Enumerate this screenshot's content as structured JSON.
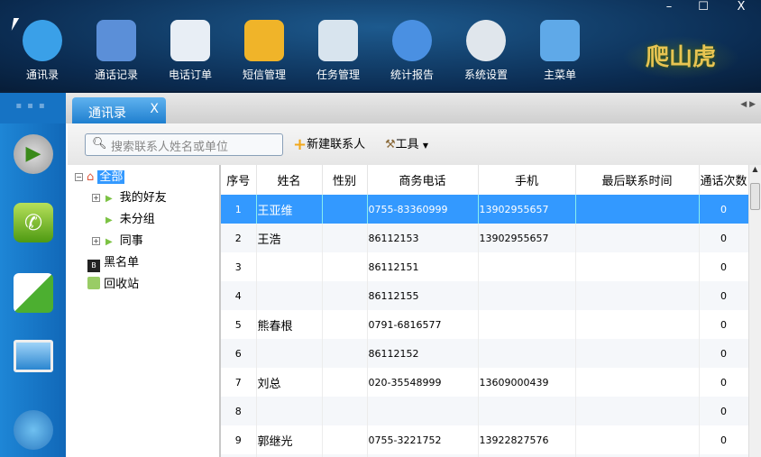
{
  "toolbar": [
    {
      "label": "通讯录",
      "icon": "contacts-icon",
      "color": "#3aa0e8"
    },
    {
      "label": "通话记录",
      "icon": "call-log-icon",
      "color": "#5b8fd8"
    },
    {
      "label": "电话订单",
      "icon": "phone-order-icon",
      "color": "#e8eef5"
    },
    {
      "label": "短信管理",
      "icon": "sms-icon",
      "color": "#f0b429"
    },
    {
      "label": "任务管理",
      "icon": "task-icon",
      "color": "#d8e4ee"
    },
    {
      "label": "统计报告",
      "icon": "pie-chart-icon",
      "color": "#4a90e2"
    },
    {
      "label": "系统设置",
      "icon": "gear-icon",
      "color": "#e0e6ec"
    },
    {
      "label": "主菜单",
      "icon": "home-icon",
      "color": "#5fa9e8"
    }
  ],
  "window": {
    "minimize": "–",
    "maximize": "☐",
    "close": "X"
  },
  "logo": "爬山虎",
  "tab": {
    "label": "通讯录",
    "close": "X"
  },
  "search": {
    "placeholder": "搜索联系人姓名或单位"
  },
  "actions": {
    "new_contact": "新建联系人",
    "tools": "工具"
  },
  "tree": {
    "root": "全部",
    "groups": [
      "我的好友",
      "未分组",
      "同事"
    ],
    "blacklist": "黑名单",
    "recycle": "回收站"
  },
  "table": {
    "columns": [
      "序号",
      "姓名",
      "性别",
      "商务电话",
      "手机",
      "最后联系时间",
      "通话次数"
    ],
    "rows": [
      [
        "1",
        "王亚维",
        "",
        "0755-83360999",
        "13902955657",
        "",
        "0"
      ],
      [
        "2",
        "王浩",
        "",
        "86112153",
        "13902955657",
        "",
        "0"
      ],
      [
        "3",
        "",
        "",
        "86112151",
        "",
        "",
        "0"
      ],
      [
        "4",
        "",
        "",
        "86112155",
        "",
        "",
        "0"
      ],
      [
        "5",
        "熊春根",
        "",
        "0791-6816577",
        "",
        "",
        "0"
      ],
      [
        "6",
        "",
        "",
        "86112152",
        "",
        "",
        "0"
      ],
      [
        "7",
        "刘总",
        "",
        "020-35548999",
        "13609000439",
        "",
        "0"
      ],
      [
        "8",
        "",
        "",
        "",
        "",
        "",
        "0"
      ],
      [
        "9",
        "郭继光",
        "",
        "0755-3221752",
        "13922827576",
        "",
        "0"
      ],
      [
        "",
        "",
        "",
        "",
        "",
        "",
        ""
      ]
    ],
    "selected_row": 0
  },
  "accent": "#3399ff"
}
